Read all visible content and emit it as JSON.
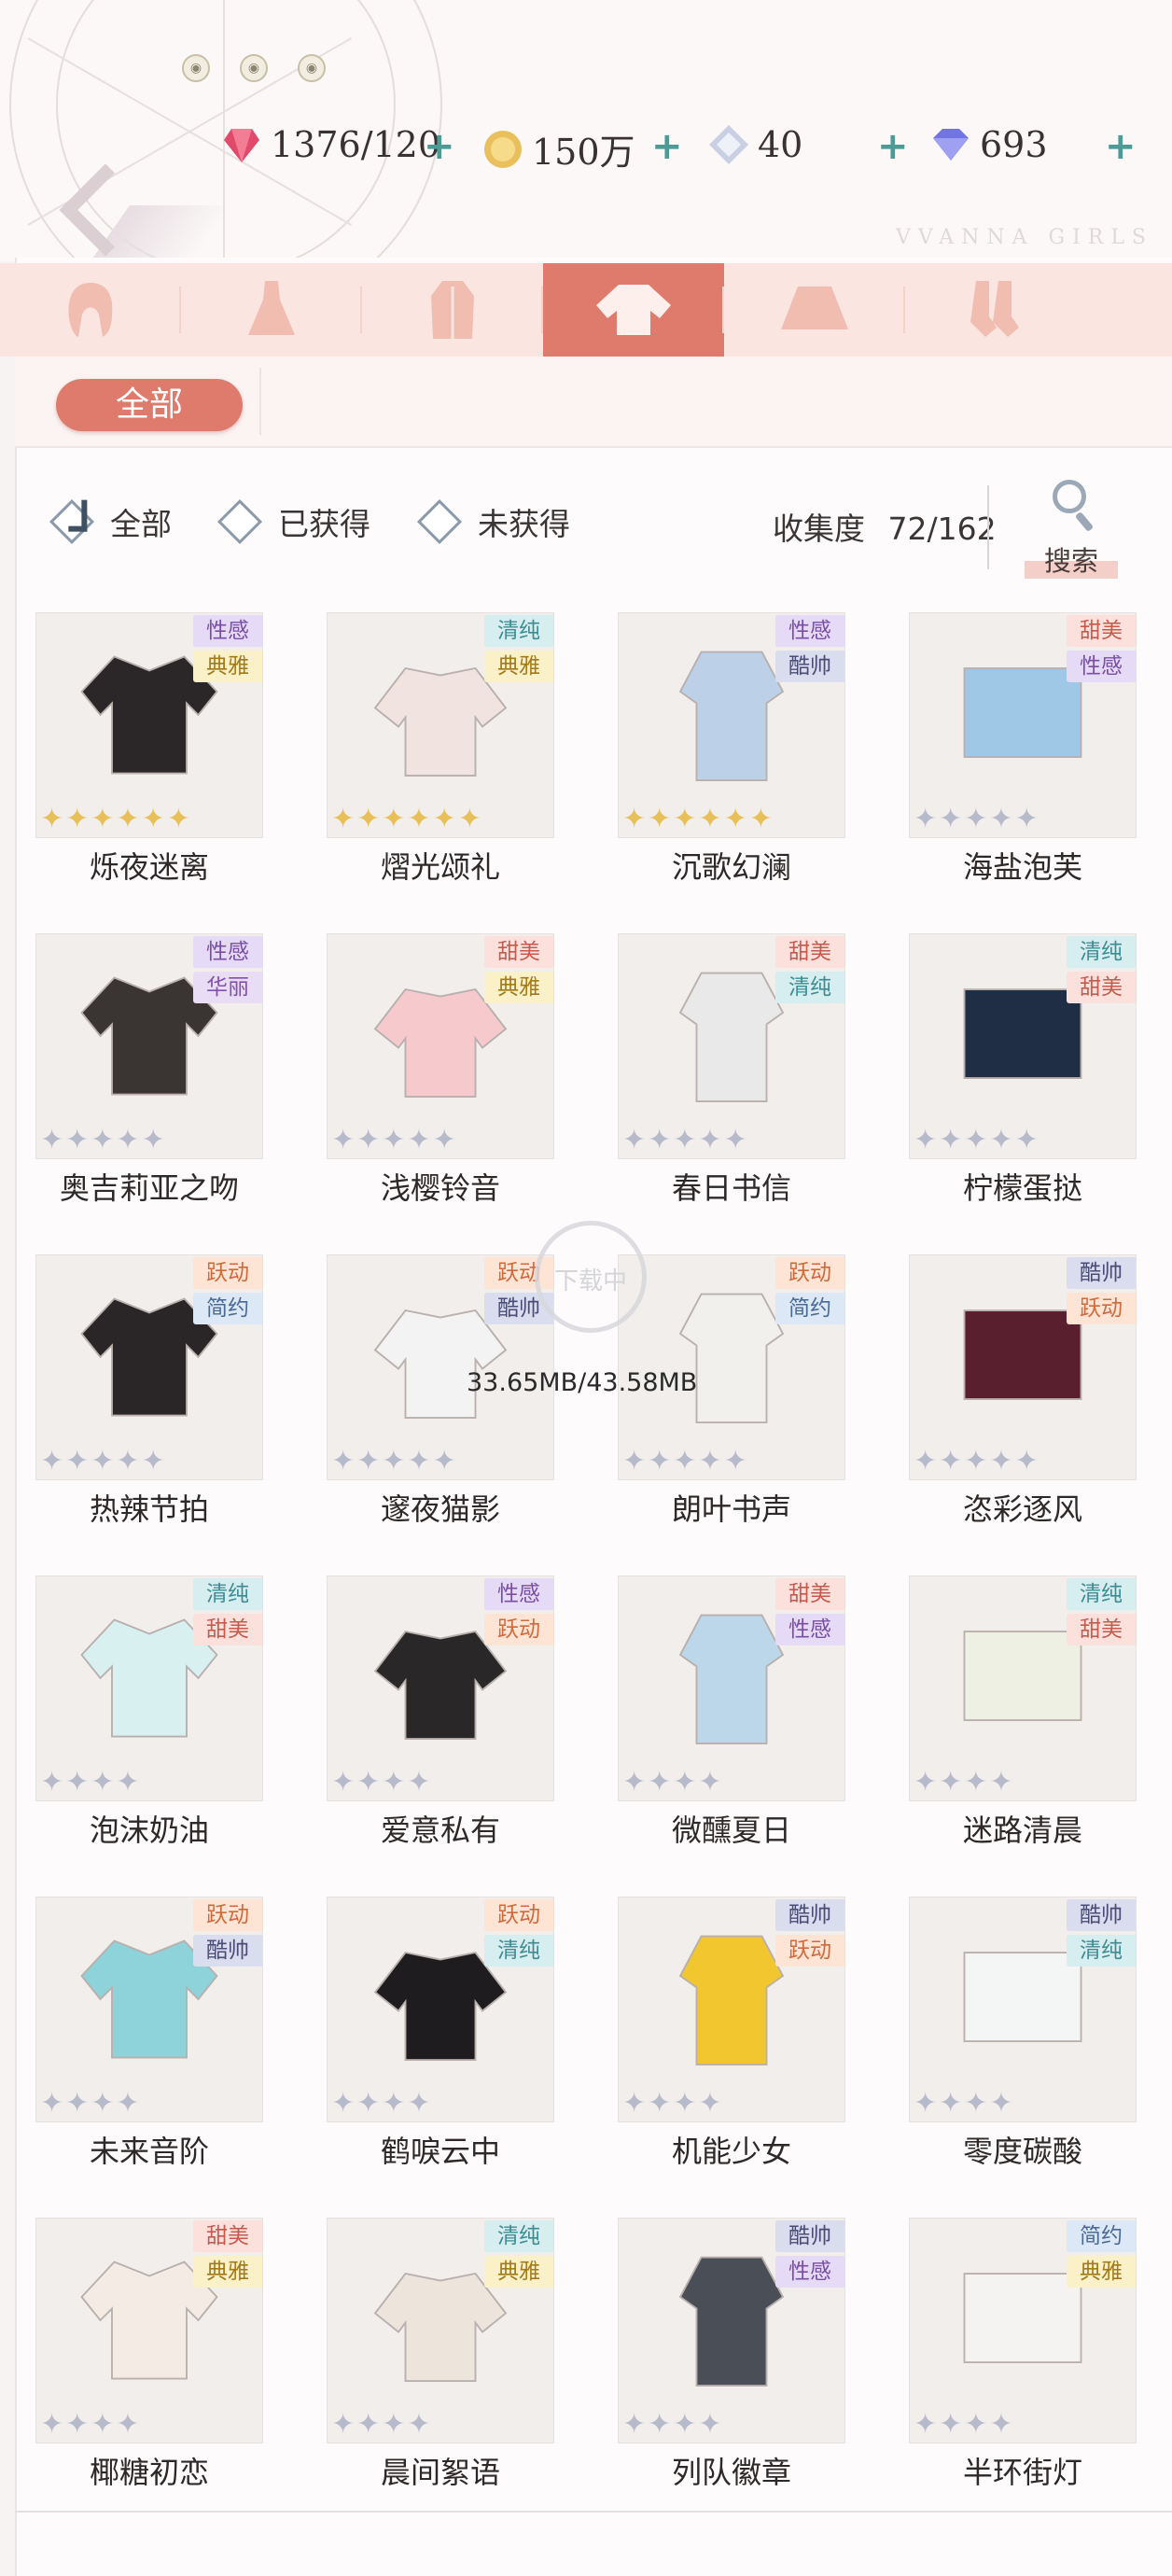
{
  "currencies": [
    {
      "name": "stamina-icon",
      "value": "1376/120",
      "color": "#e14a6b"
    },
    {
      "name": "gold-coin-icon",
      "value": "150万",
      "color": "#e6b54a"
    },
    {
      "name": "crystal-icon",
      "value": "40",
      "color": "#9aa6c8"
    },
    {
      "name": "diamond-icon",
      "value": "693",
      "color": "#6a6ae0"
    }
  ],
  "plus": "+",
  "brand": "VVANNA GIRLS",
  "categories": [
    "hair-icon",
    "dress-icon",
    "coat-icon",
    "top-icon",
    "skirt-icon",
    "socks-icon"
  ],
  "active_category": 3,
  "all_tab": "全部",
  "filters": {
    "all": "全部",
    "owned": "已获得",
    "unowned": "未获得"
  },
  "collection": {
    "label": "收集度",
    "value": "72/162"
  },
  "search_label": "搜索",
  "download": {
    "status": "下载中",
    "size": "33.65MB/43.58MB"
  },
  "items": [
    {
      "name": "烁夜迷离",
      "tags": [
        "性感",
        "典雅"
      ],
      "stars": 6,
      "gold": true
    },
    {
      "name": "熠光颂礼",
      "tags": [
        "清纯",
        "典雅"
      ],
      "stars": 6,
      "gold": true
    },
    {
      "name": "沉歌幻澜",
      "tags": [
        "性感",
        "酷帅"
      ],
      "stars": 6,
      "gold": true
    },
    {
      "name": "海盐泡芙",
      "tags": [
        "甜美",
        "性感"
      ],
      "stars": 5,
      "gold": false
    },
    {
      "name": "奥吉莉亚之吻",
      "tags": [
        "性感",
        "华丽"
      ],
      "stars": 5,
      "gold": false
    },
    {
      "name": "浅樱铃音",
      "tags": [
        "甜美",
        "典雅"
      ],
      "stars": 5,
      "gold": false
    },
    {
      "name": "春日书信",
      "tags": [
        "甜美",
        "清纯"
      ],
      "stars": 5,
      "gold": false
    },
    {
      "name": "柠檬蛋挞",
      "tags": [
        "清纯",
        "甜美"
      ],
      "stars": 5,
      "gold": false
    },
    {
      "name": "热辣节拍",
      "tags": [
        "跃动",
        "简约"
      ],
      "stars": 5,
      "gold": false
    },
    {
      "name": "邃夜猫影",
      "tags": [
        "跃动",
        "酷帅"
      ],
      "stars": 5,
      "gold": false
    },
    {
      "name": "朗叶书声",
      "tags": [
        "跃动",
        "简约"
      ],
      "stars": 5,
      "gold": false
    },
    {
      "name": "恣彩逐风",
      "tags": [
        "酷帅",
        "跃动"
      ],
      "stars": 5,
      "gold": false
    },
    {
      "name": "泡沫奶油",
      "tags": [
        "清纯",
        "甜美"
      ],
      "stars": 4,
      "gold": false
    },
    {
      "name": "爱意私有",
      "tags": [
        "性感",
        "跃动"
      ],
      "stars": 4,
      "gold": false
    },
    {
      "name": "微醺夏日",
      "tags": [
        "甜美",
        "性感"
      ],
      "stars": 4,
      "gold": false
    },
    {
      "name": "迷路清晨",
      "tags": [
        "清纯",
        "甜美"
      ],
      "stars": 4,
      "gold": false
    },
    {
      "name": "未来音阶",
      "tags": [
        "跃动",
        "酷帅"
      ],
      "stars": 4,
      "gold": false
    },
    {
      "name": "鹤唳云中",
      "tags": [
        "跃动",
        "清纯"
      ],
      "stars": 4,
      "gold": false
    },
    {
      "name": "机能少女",
      "tags": [
        "酷帅",
        "跃动"
      ],
      "stars": 4,
      "gold": false
    },
    {
      "name": "零度碳酸",
      "tags": [
        "酷帅",
        "清纯"
      ],
      "stars": 4,
      "gold": false
    },
    {
      "name": "椰糖初恋",
      "tags": [
        "甜美",
        "典雅"
      ],
      "stars": 4,
      "gold": false
    },
    {
      "name": "晨间絮语",
      "tags": [
        "清纯",
        "典雅"
      ],
      "stars": 4,
      "gold": false
    },
    {
      "name": "列队徽章",
      "tags": [
        "酷帅",
        "性感"
      ],
      "stars": 4,
      "gold": false
    },
    {
      "name": "半环街灯",
      "tags": [
        "简约",
        "典雅"
      ],
      "stars": 4,
      "gold": false
    }
  ],
  "garment_colors": [
    "#2b2628",
    "#f1e3df",
    "#bcd0e8",
    "#9fc7e6",
    "#3a3432",
    "#f6c9cc",
    "#e9e9ea",
    "#1f2d45",
    "#2a2628",
    "#f3f3f3",
    "#f1f0ec",
    "#5a1f2e",
    "#d8f0f0",
    "#2a2728",
    "#bcd6ea",
    "#eef0e4",
    "#8ed2da",
    "#1e1c1e",
    "#f2c62e",
    "#f4f6f6",
    "#f3ebe4",
    "#ede4dc",
    "#4a4e57",
    "#f5f3f1"
  ]
}
